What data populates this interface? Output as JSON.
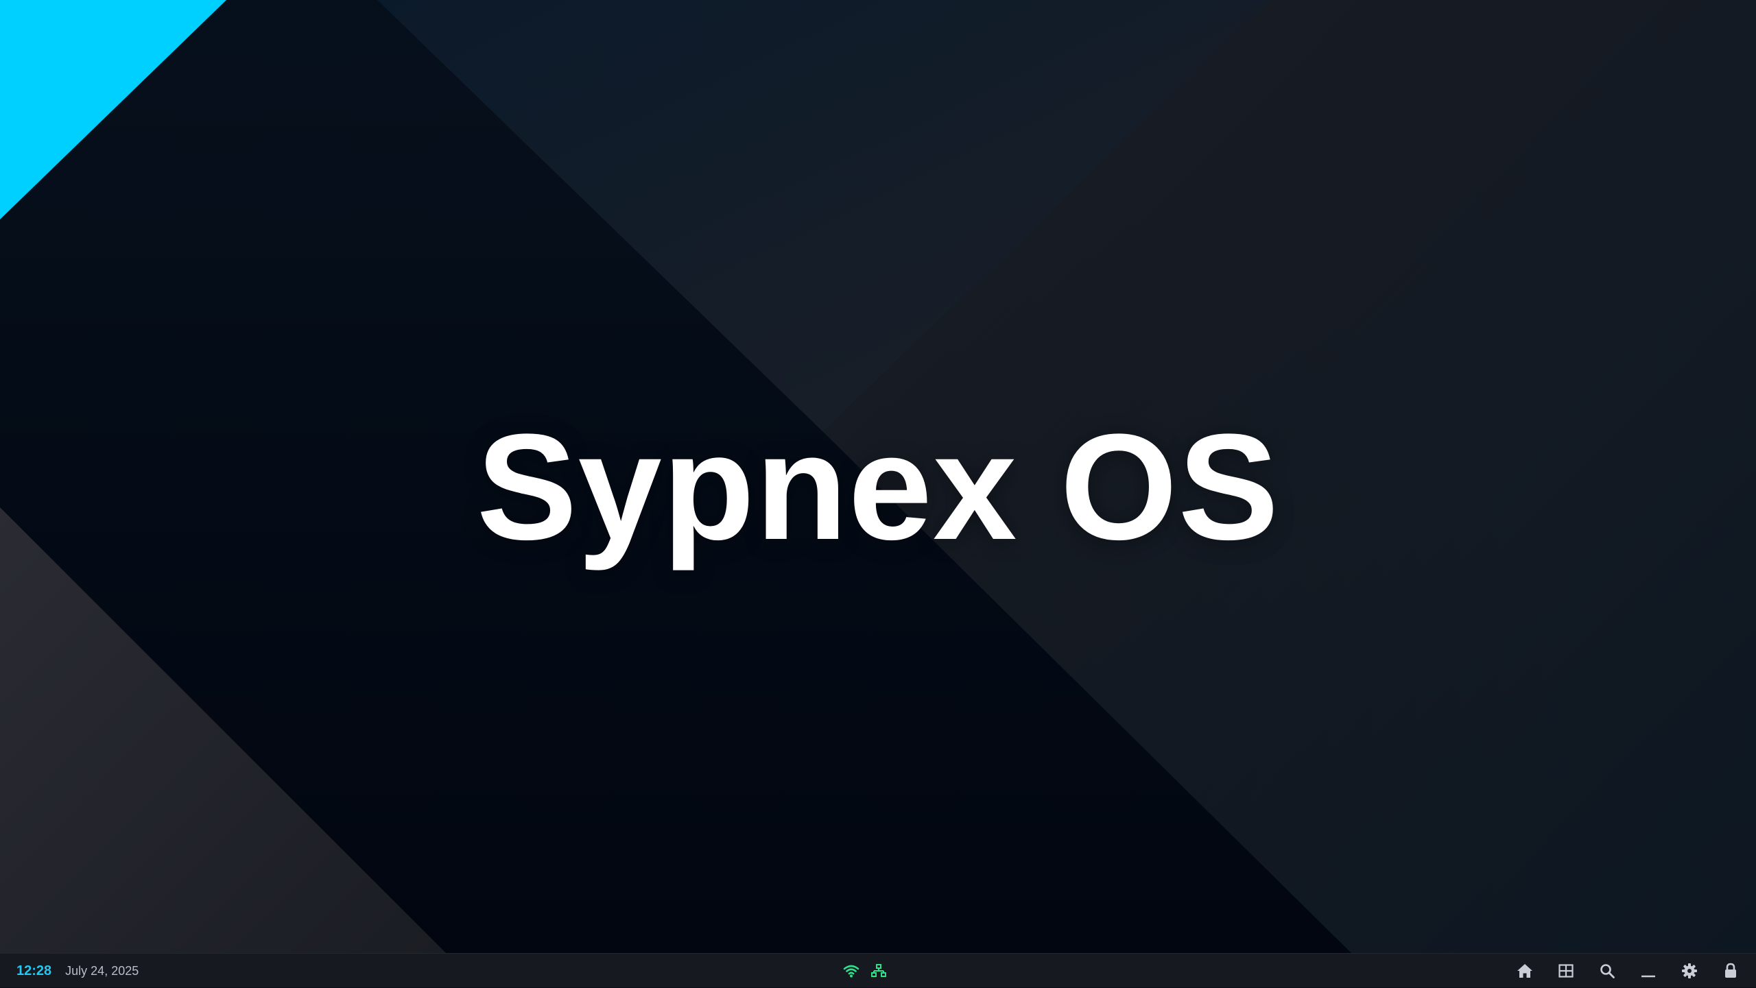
{
  "desktop": {
    "brand_text": "Sypnex OS",
    "colors": {
      "accent": "#00d0ff",
      "background": "#0b0f17"
    }
  },
  "taskbar": {
    "clock": "12:28",
    "date": "July 24, 2025",
    "status_icons": [
      "wifi-icon",
      "network-icon"
    ],
    "status_color": "#2fe08a",
    "buttons": [
      "home-icon",
      "app-grid-icon",
      "search-icon",
      "minimize-icon",
      "gear-icon",
      "lock-icon"
    ],
    "icon_color": "#c9ced6"
  }
}
